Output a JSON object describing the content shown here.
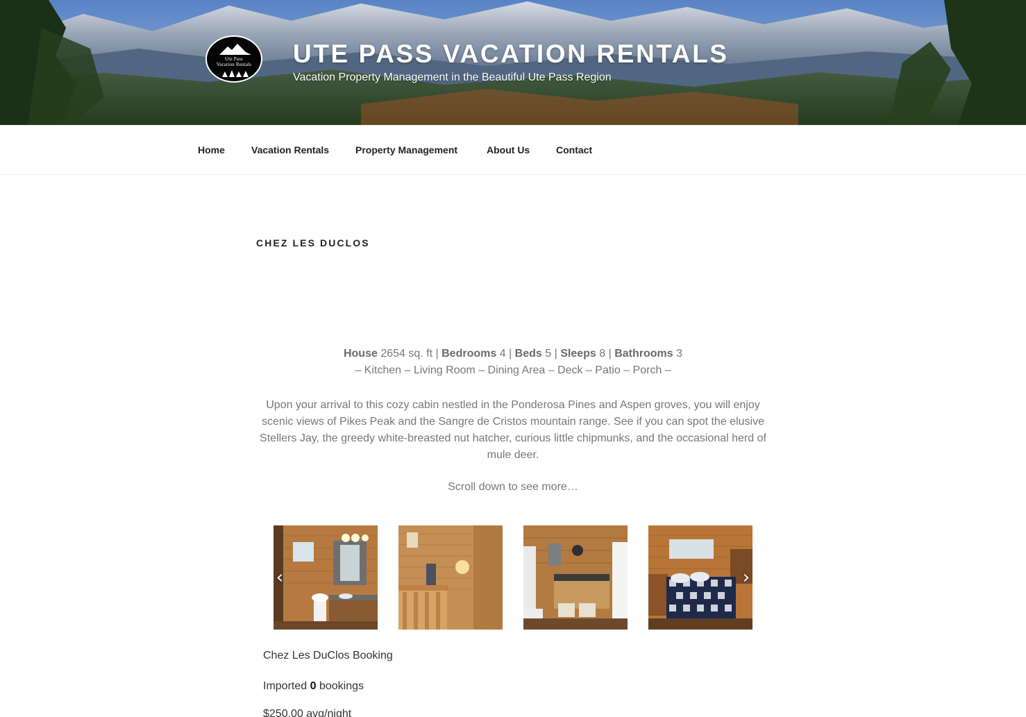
{
  "header": {
    "logo_line1": "Ute Pass",
    "logo_line2": "Vacation Rentals",
    "site_title": "UTE PASS VACATION RENTALS",
    "tagline": "Vacation Property Management in the Beautiful Ute Pass Region"
  },
  "nav": {
    "items": [
      "Home",
      "Vacation Rentals",
      "Property Management",
      "About Us",
      "Contact"
    ]
  },
  "page": {
    "title": "CHEZ LES DUCLOS",
    "specs": {
      "house_label": "House",
      "house_value": "2654 sq. ft",
      "bedrooms_label": "Bedrooms",
      "bedrooms_value": "4",
      "beds_label": "Beds",
      "beds_value": "5",
      "sleeps_label": "Sleeps",
      "sleeps_value": "8",
      "bathrooms_label": "Bathrooms",
      "bathrooms_value": "3",
      "separator": "|"
    },
    "rooms": "– Kitchen – Living Room – Dining Area – Deck – Patio – Porch –",
    "description": "Upon your arrival to this cozy cabin nestled in the Ponderosa Pines and Aspen groves, you will enjoy scenic views of Pikes Peak and the Sangre de Cristos mountain range. See if you can spot the elusive Stellers Jay, the greedy white-breasted nut hatcher, curious little chipmunks, and the occasional herd of mule deer.",
    "scroll_note": "Scroll down to see more…",
    "gallery": {
      "prev_glyph": "‹",
      "next_glyph": "›"
    },
    "booking": {
      "title": "Chez Les DuClos Booking",
      "imported_prefix": "Imported",
      "imported_count": "0",
      "imported_suffix": "bookings",
      "price": "$250.00 avg/night"
    }
  },
  "colors": {
    "body_text": "#777777",
    "heading_text": "#222222",
    "wood": "#b9834a"
  }
}
